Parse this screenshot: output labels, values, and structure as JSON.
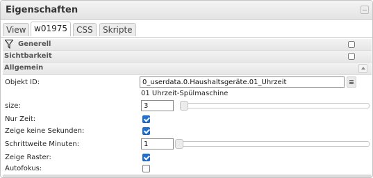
{
  "panel": {
    "title": "Eigenschaften"
  },
  "tabs": [
    {
      "label": "View",
      "active": false
    },
    {
      "label": "w01975",
      "active": true
    },
    {
      "label": "CSS",
      "active": false
    },
    {
      "label": "Skripte",
      "active": false
    }
  ],
  "groups": {
    "generell": {
      "label": "Generell",
      "checked": false
    },
    "sichtbarkeit": {
      "label": "Sichtbarkeit",
      "checked": false
    },
    "allgemein": {
      "label": "Allgemein"
    }
  },
  "fields": {
    "objekt_id": {
      "label": "Objekt ID:",
      "value": "0_userdata.0.Haushaltsgeräte.01_Uhrzeit",
      "description": "01 Uhrzeit-Spülmaschine"
    },
    "size": {
      "label": "size:",
      "value": "3",
      "slider_fraction": 0.0
    },
    "nur_zeit": {
      "label": "Nur Zeit:",
      "checked": true
    },
    "zeige_keine_sekunden": {
      "label": "Zeige keine Sekunden:",
      "checked": true
    },
    "schrittweite": {
      "label": "Schrittweite Minuten:",
      "value": "1",
      "slider_fraction": 0.0
    },
    "zeige_raster": {
      "label": "Zeige Raster:",
      "checked": true
    },
    "autofokus": {
      "label": "Autofokus:",
      "checked": false
    }
  },
  "icons": {
    "filter": "filter-icon",
    "collapse": "minimize-icon",
    "scroll_up": "arrow-up-icon",
    "browse": "list-icon"
  },
  "colors": {
    "checkbox_on": "#1f71d6",
    "border": "#c5c5c5"
  }
}
